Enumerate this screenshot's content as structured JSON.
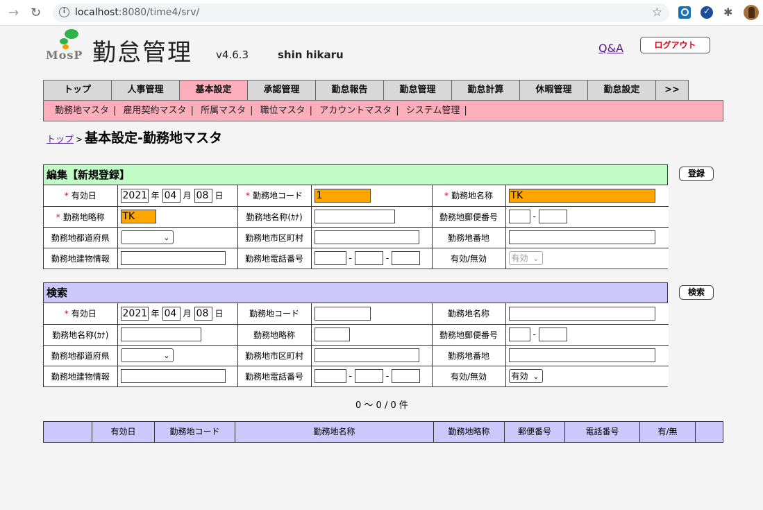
{
  "browser": {
    "url_host": "localhost",
    "url_path": ":8080/time4/srv/"
  },
  "header": {
    "logo_text": "MosP",
    "title": "勤怠管理",
    "version": "v4.6.3",
    "user": "shin hikaru",
    "qa_label": "Q&A",
    "logout_label": "ログアウト"
  },
  "tabs": [
    {
      "label": "トップ"
    },
    {
      "label": "人事管理"
    },
    {
      "label": "基本設定",
      "active": true
    },
    {
      "label": "承認管理"
    },
    {
      "label": "勤怠報告"
    },
    {
      "label": "勤怠管理"
    },
    {
      "label": "勤怠計算"
    },
    {
      "label": "休暇管理"
    },
    {
      "label": "勤怠設定"
    },
    {
      "label": ">>"
    }
  ],
  "submenu": [
    "勤務地マスタ",
    "雇用契約マスタ",
    "所属マスタ",
    "職位マスタ",
    "アカウントマスタ",
    "システム管理"
  ],
  "submenu_sep": "|",
  "breadcrumb": {
    "top": "トップ",
    "arrow": ">",
    "title": "基本設定-勤務地マスタ"
  },
  "edit": {
    "title": "編集【新規登録】",
    "button": "登録",
    "required_mark": "*",
    "labels": {
      "effective_date": "有効日",
      "code": "勤務地コード",
      "name": "勤務地名称",
      "abbr": "勤務地略称",
      "name_kana": "勤務地名称(ｶﾅ)",
      "postal": "勤務地郵便番号",
      "prefecture": "勤務地都道府県",
      "city": "勤務地市区町村",
      "address": "勤務地番地",
      "building": "勤務地建物情報",
      "phone": "勤務地電話番号",
      "active": "有効/無効"
    },
    "values": {
      "year": "2021",
      "month": "04",
      "day": "08",
      "code": "1",
      "name": "TK",
      "abbr": "TK",
      "active": "有効"
    }
  },
  "search": {
    "title": "検索",
    "button": "検索",
    "values": {
      "year": "2021",
      "month": "04",
      "day": "08",
      "active": "有効"
    }
  },
  "units": {
    "year": "年",
    "month": "月",
    "day": "日",
    "dash": "-"
  },
  "result_count": "0 ～ 0 / 0 件",
  "results_columns": [
    "",
    "有効日",
    "勤務地コード",
    "勤務地名称",
    "勤務地略称",
    "郵便番号",
    "電話番号",
    "有/無",
    ""
  ]
}
